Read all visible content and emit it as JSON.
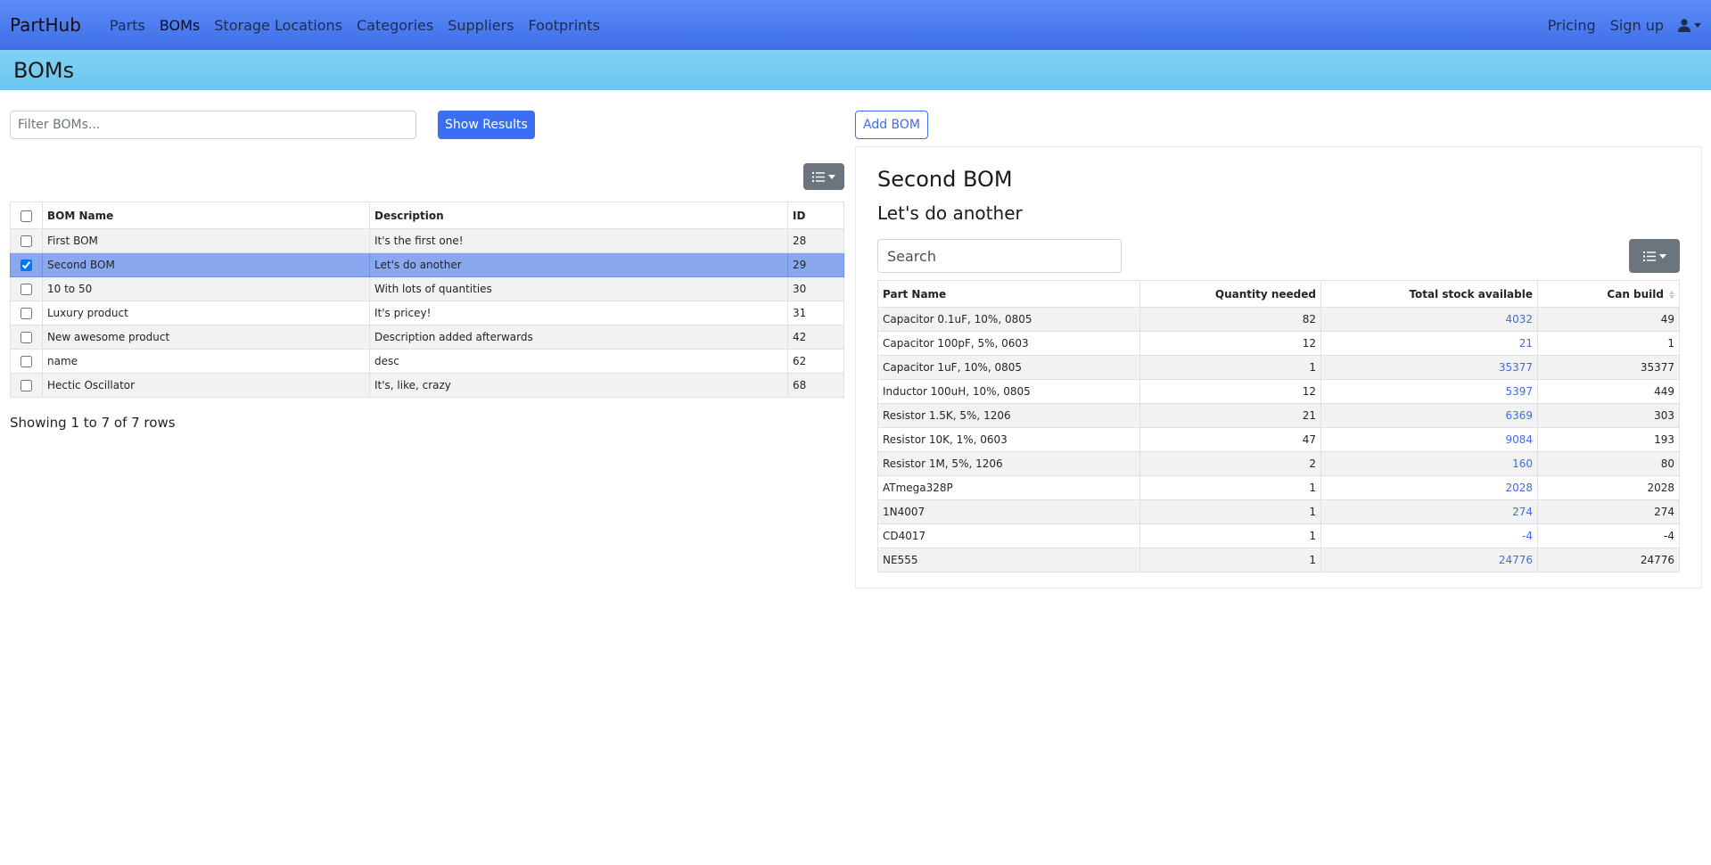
{
  "nav": {
    "brand": "PartHub",
    "links": [
      "Parts",
      "BOMs",
      "Storage Locations",
      "Categories",
      "Suppliers",
      "Footprints"
    ],
    "right_links": [
      "Pricing",
      "Sign up"
    ]
  },
  "page_title": "BOMs",
  "filter": {
    "placeholder": "Filter BOMs...",
    "button_label": "Show Results"
  },
  "add_button_label": "Add BOM",
  "bom_table": {
    "headers": [
      "BOM Name",
      "Description",
      "ID"
    ],
    "rows": [
      {
        "name": "First BOM",
        "description": "It's the first one!",
        "id": "28",
        "selected": false
      },
      {
        "name": "Second BOM",
        "description": "Let's do another",
        "id": "29",
        "selected": true
      },
      {
        "name": "10 to 50",
        "description": "With lots of quantities",
        "id": "30",
        "selected": false
      },
      {
        "name": "Luxury product",
        "description": "It's pricey!",
        "id": "31",
        "selected": false
      },
      {
        "name": "New awesome product",
        "description": "Description added afterwards",
        "id": "42",
        "selected": false
      },
      {
        "name": "name",
        "description": "desc",
        "id": "62",
        "selected": false
      },
      {
        "name": "Hectic Oscillator",
        "description": "It's, like, crazy",
        "id": "68",
        "selected": false
      }
    ],
    "showing": "Showing 1 to 7 of 7 rows"
  },
  "detail": {
    "title": "Second BOM",
    "subtitle": "Let's do another",
    "search_placeholder": "Search",
    "headers": [
      "Part Name",
      "Quantity needed",
      "Total stock available",
      "Can build"
    ],
    "rows": [
      [
        "Capacitor 0.1uF, 10%, 0805",
        "82",
        "4032",
        "49"
      ],
      [
        "Capacitor 100pF, 5%, 0603",
        "12",
        "21",
        "1"
      ],
      [
        "Capacitor 1uF, 10%, 0805",
        "1",
        "35377",
        "35377"
      ],
      [
        "Inductor 100uH, 10%, 0805",
        "12",
        "5397",
        "449"
      ],
      [
        "Resistor 1.5K, 5%, 1206",
        "21",
        "6369",
        "303"
      ],
      [
        "Resistor 10K, 1%, 0603",
        "47",
        "9084",
        "193"
      ],
      [
        "Resistor 1M, 5%, 1206",
        "2",
        "160",
        "80"
      ],
      [
        "ATmega328P",
        "1",
        "2028",
        "2028"
      ],
      [
        "1N4007",
        "1",
        "274",
        "274"
      ],
      [
        "CD4017",
        "1",
        "-4",
        "-4"
      ],
      [
        "NE555",
        "1",
        "24776",
        "24776"
      ]
    ]
  },
  "colors": {
    "primary": "#3b6ef2",
    "navbar": "#4a7df0",
    "titlebar": "#74cbf1",
    "selected_row": "#8aa8ee"
  }
}
